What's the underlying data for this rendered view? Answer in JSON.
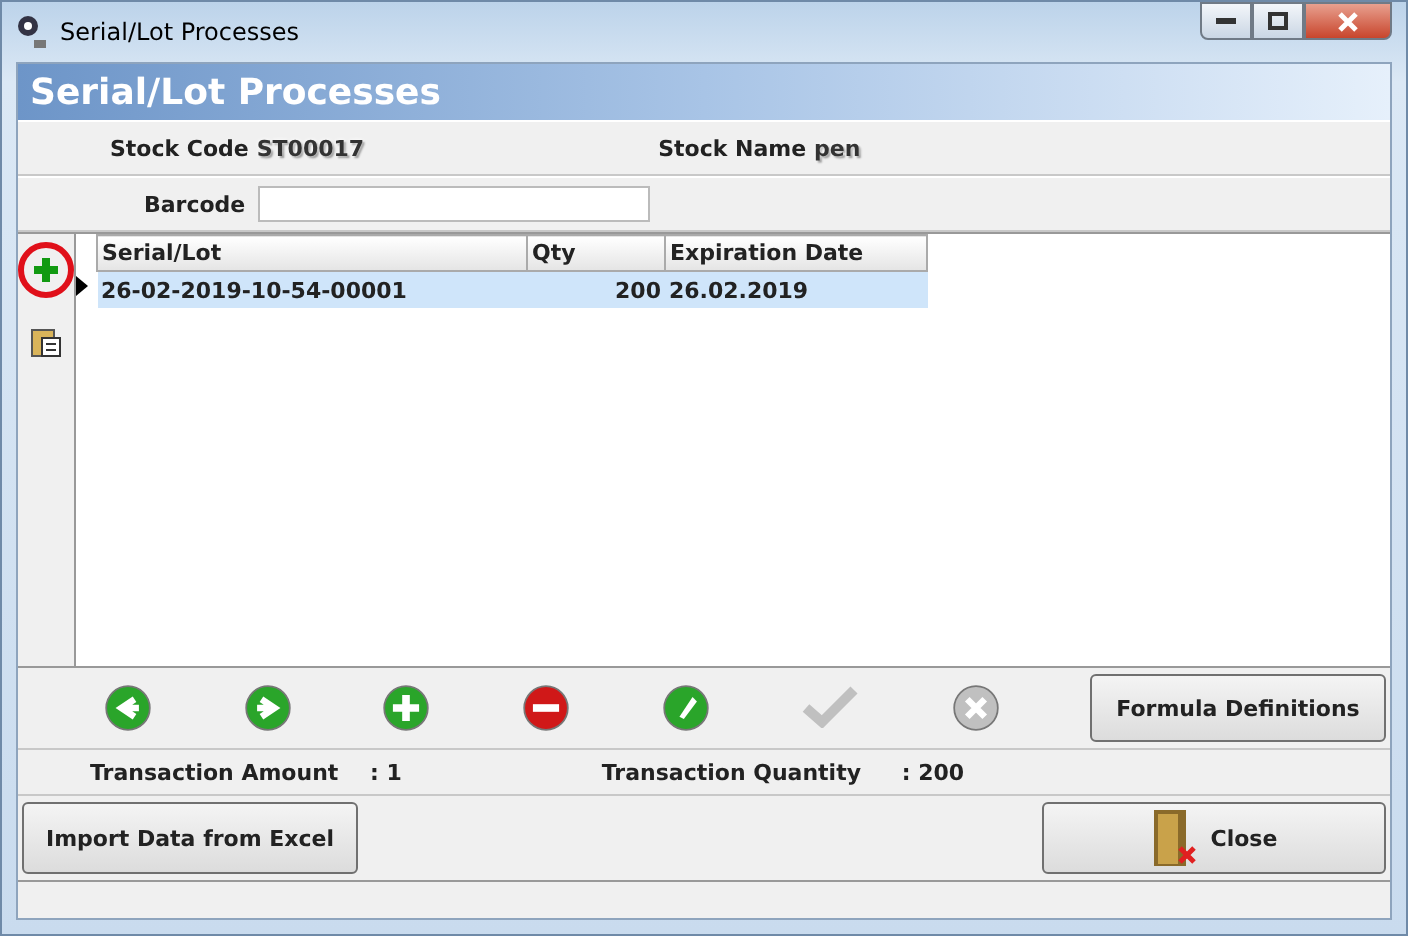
{
  "window": {
    "title": "Serial/Lot Processes"
  },
  "header": {
    "title": "Serial/Lot Processes"
  },
  "stock": {
    "code_label": "Stock Code",
    "code": "ST00017",
    "name_label": "Stock Name",
    "name": "pen"
  },
  "barcode": {
    "label": "Barcode"
  },
  "side_tools": [
    {
      "kind": "add",
      "highlighted": true
    },
    {
      "kind": "paste",
      "highlighted": false
    }
  ],
  "table": {
    "columns": [
      "Serial/Lot",
      "Qty",
      "Expiration Date"
    ],
    "rows": [
      {
        "selected": true,
        "cells": [
          "26-02-2019-10-54-00001",
          "200",
          "26.02.2019"
        ]
      }
    ]
  },
  "toolbar": [
    {
      "kind": "prev",
      "disabled": false
    },
    {
      "kind": "next",
      "disabled": false
    },
    {
      "kind": "add",
      "disabled": false
    },
    {
      "kind": "delete",
      "disabled": false
    },
    {
      "kind": "edit",
      "disabled": false
    },
    {
      "kind": "confirm",
      "disabled": true
    },
    {
      "kind": "cancel",
      "disabled": true
    }
  ],
  "formula_button": "Formula Definitions",
  "totals": [
    {
      "label": "Transaction Amount",
      "value": ": 1"
    },
    {
      "label": "Transaction Quantity",
      "value": ": 200"
    }
  ],
  "import_button": "Import Data from Excel",
  "close_button": "Close"
}
